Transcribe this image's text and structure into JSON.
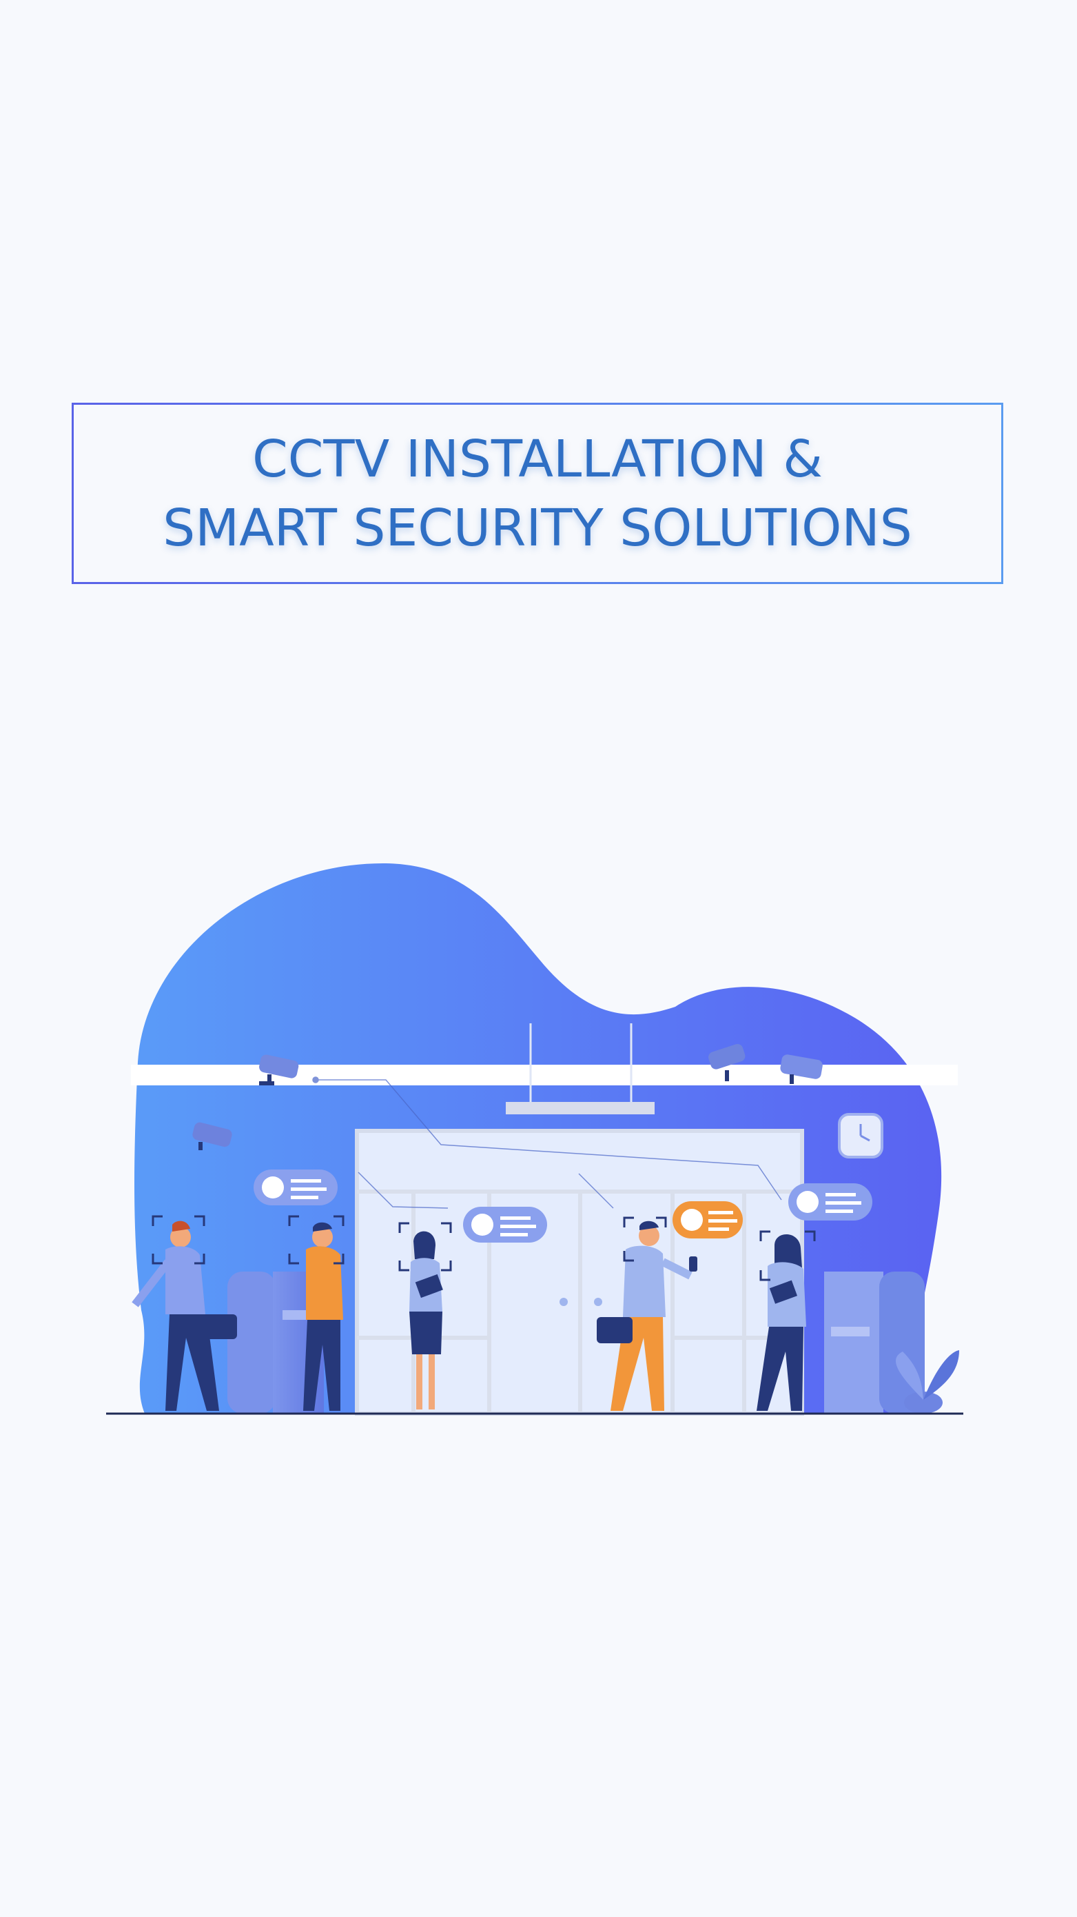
{
  "heading": {
    "line1": "CCTV INSTALLATION &",
    "line2": "SMART SECURITY SOLUTIONS"
  },
  "illustration": {
    "icons": [
      "cctv-camera-icon",
      "clock-icon",
      "face-id-icon",
      "plant-icon",
      "kiosk-icon"
    ]
  },
  "colors": {
    "background": "#f7f9fd",
    "title": "#2f6fc4",
    "blob_start": "#5a9bf8",
    "blob_end": "#5a63f2",
    "accent_orange": "#f2963a",
    "navy": "#26387a"
  }
}
